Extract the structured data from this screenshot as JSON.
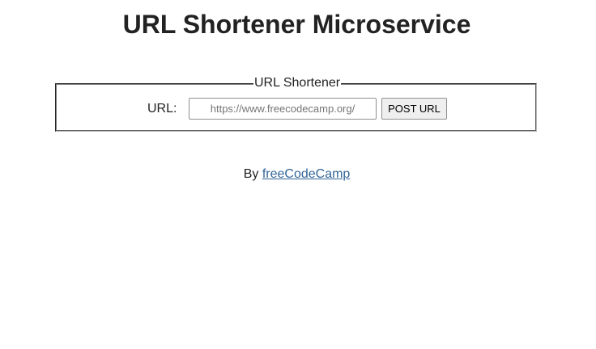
{
  "header": {
    "title": "URL Shortener Microservice"
  },
  "form": {
    "legend": "URL Shortener",
    "url_label": "URL:",
    "url_input": {
      "value": "",
      "placeholder": "https://www.freecodecamp.org/"
    },
    "submit_label": "POST URL"
  },
  "footer": {
    "prefix": "By",
    "link_text": "freeCodeCamp"
  },
  "colors": {
    "link": "#336699",
    "text": "#222222"
  }
}
